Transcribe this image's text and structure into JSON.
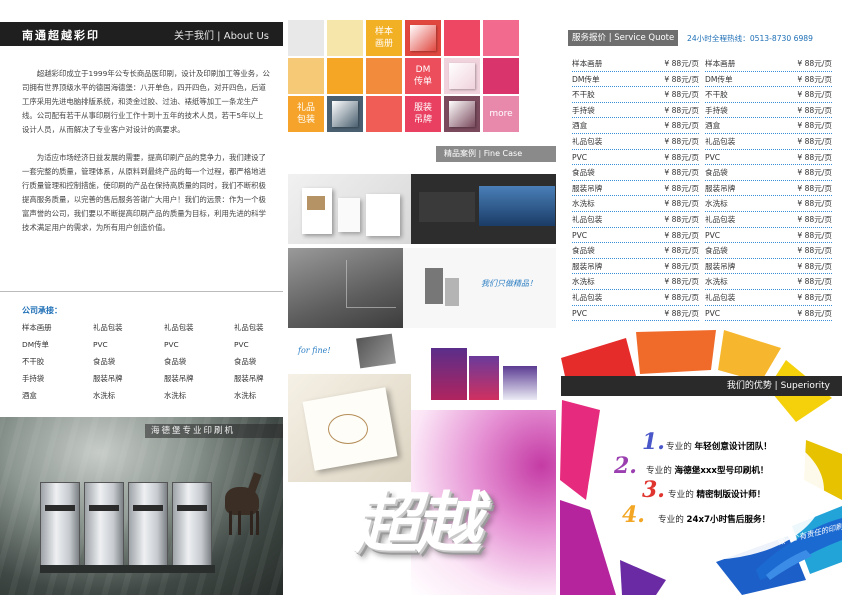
{
  "panel1": {
    "brand": "南通超越彩印",
    "about": "关于我们 | About Us",
    "intro": [
      "超越彩印成立于1999年公专长商品医印刷，设计及印刷加工等业务，公司拥有世界顶级水平的德国海德堡：八开单色，四开四色，对开四色，后道工序采用先进电脑排版系统，和烫金过胶、过油、裱纸等加工一条龙生产线。公司配有若干从事印刷行业工作十到十五年的技术人员，若干5年以上设计人员，从而解决了专业客户对设计的高要求。",
      "为适应市场经济日益发展的需要，提高印刷产品的竞争力，我们建设了一套完整的质量，管理体系，从原料到最终产品的每一个过程，都严格地进行质量管理和控制措施，使印刷的产品在保持高质量的同时，我们不断积极提高服务质量，以完善的售后服务答谢广大用户！我们的远景：作为一个极富声誉的公司，我们要以不断提高印刷产品的质量为目标，利用先进的科学技术满足用户的需求，为所有用户创造价值。"
    ],
    "services_title": "公司承接：",
    "services": [
      "样本画册",
      "礼品包装",
      "礼品包装",
      "礼品包装",
      "DM传单",
      "PVC",
      "PVC",
      "PVC",
      "不干胶",
      "食品袋",
      "食品袋",
      "食品袋",
      "手持袋",
      "服装吊牌",
      "服装吊牌",
      "服装吊牌",
      "酒盒",
      "水洗标",
      "水洗标",
      "水洗标"
    ],
    "press_label": "海德堡专业印刷机"
  },
  "panel2": {
    "tiles": [
      {
        "type": "color",
        "color": "#e8e8e8"
      },
      {
        "type": "color",
        "color": "#f6e6a9"
      },
      {
        "type": "label",
        "color": "#f2b024",
        "lines": [
          "样本",
          "画册"
        ]
      },
      {
        "type": "thumb",
        "color": "#e0473f"
      },
      {
        "type": "color",
        "color": "#ee4763"
      },
      {
        "type": "color",
        "color": "#f26a8d"
      },
      {
        "type": "color",
        "color": "#f6c977"
      },
      {
        "type": "color",
        "color": "#f5a625"
      },
      {
        "type": "color",
        "color": "#f28c3c"
      },
      {
        "type": "label",
        "color": "#ec4e5c",
        "lines": [
          "DM",
          "传单"
        ]
      },
      {
        "type": "thumb",
        "color": "#f0d2dc"
      },
      {
        "type": "color",
        "color": "#d9356c"
      },
      {
        "type": "label",
        "color": "#f5a32a",
        "lines": [
          "礼品",
          "包装"
        ]
      },
      {
        "type": "thumb",
        "color": "#4a6070"
      },
      {
        "type": "color",
        "color": "#ef5d56"
      },
      {
        "type": "label",
        "color": "#e93f61",
        "lines": [
          "服装",
          "吊牌"
        ]
      },
      {
        "type": "thumb",
        "color": "#7a4a5c"
      },
      {
        "type": "label",
        "color": "#e889ac",
        "lines": [
          "more"
        ]
      }
    ],
    "case_title": "精品案例 | Fine Case",
    "case_captions": [
      "我们只做精品！",
      "for fine!"
    ],
    "big_word": "超越"
  },
  "panel3": {
    "quote_title": "服务报价 | Service Quote",
    "hotline": "24小时全程热线：0513-8730 6989",
    "prices_left": [
      {
        "name": "样本画册",
        "price": "¥ 88元/页"
      },
      {
        "name": "DM传单",
        "price": "¥ 88元/页"
      },
      {
        "name": "不干胶",
        "price": "¥ 88元/页"
      },
      {
        "name": "手持袋",
        "price": "¥ 88元/页"
      },
      {
        "name": "酒盒",
        "price": "¥ 88元/页"
      },
      {
        "name": "礼品包装",
        "price": "¥ 88元/页"
      },
      {
        "name": "PVC",
        "price": "¥ 88元/页"
      },
      {
        "name": "食品袋",
        "price": "¥ 88元/页"
      },
      {
        "name": "服装吊牌",
        "price": "¥ 88元/页"
      },
      {
        "name": "水洗标",
        "price": "¥ 88元/页"
      },
      {
        "name": "礼品包装",
        "price": "¥ 88元/页"
      },
      {
        "name": "PVC",
        "price": "¥ 88元/页"
      },
      {
        "name": "食品袋",
        "price": "¥ 88元/页"
      },
      {
        "name": "服装吊牌",
        "price": "¥ 88元/页"
      },
      {
        "name": "水洗标",
        "price": "¥ 88元/页"
      },
      {
        "name": "礼品包装",
        "price": "¥ 88元/页"
      },
      {
        "name": "PVC",
        "price": "¥ 88元/页"
      }
    ],
    "prices_right": [
      {
        "name": "样本画册",
        "price": "¥ 88元/页"
      },
      {
        "name": "DM传单",
        "price": "¥ 88元/页"
      },
      {
        "name": "不干胶",
        "price": "¥ 88元/页"
      },
      {
        "name": "手持袋",
        "price": "¥ 88元/页"
      },
      {
        "name": "酒盒",
        "price": "¥ 88元/页"
      },
      {
        "name": "礼品包装",
        "price": "¥ 88元/页"
      },
      {
        "name": "PVC",
        "price": "¥ 88元/页"
      },
      {
        "name": "食品袋",
        "price": "¥ 88元/页"
      },
      {
        "name": "服装吊牌",
        "price": "¥ 88元/页"
      },
      {
        "name": "水洗标",
        "price": "¥ 88元/页"
      },
      {
        "name": "礼品包装",
        "price": "¥ 88元/页"
      },
      {
        "name": "PVC",
        "price": "¥ 88元/页"
      },
      {
        "name": "食品袋",
        "price": "¥ 88元/页"
      },
      {
        "name": "服装吊牌",
        "price": "¥ 88元/页"
      },
      {
        "name": "水洗标",
        "price": "¥ 88元/页"
      },
      {
        "name": "礼品包装",
        "price": "¥ 88元/页"
      },
      {
        "name": "PVC",
        "price": "¥ 88元/页"
      }
    ],
    "superiority_title": "我们的优势 | Superiority",
    "advantages": [
      {
        "num": "1.",
        "color": "#4a57c9",
        "pre": "专业的",
        "highlight": "年轻创意设计团队！"
      },
      {
        "num": "2.",
        "color": "#9b3fb0",
        "pre": "专业的",
        "highlight": "海德堡xxx型号印刷机！"
      },
      {
        "num": "3.",
        "color": "#e0352f",
        "pre": "专业的",
        "highlight": "精密制版设计师！"
      },
      {
        "num": "4.",
        "color": "#f2a623",
        "pre": "专业的",
        "highlight": "24x7小时售后服务！"
      }
    ],
    "slogan": "做一个有责任的印刷企业"
  }
}
